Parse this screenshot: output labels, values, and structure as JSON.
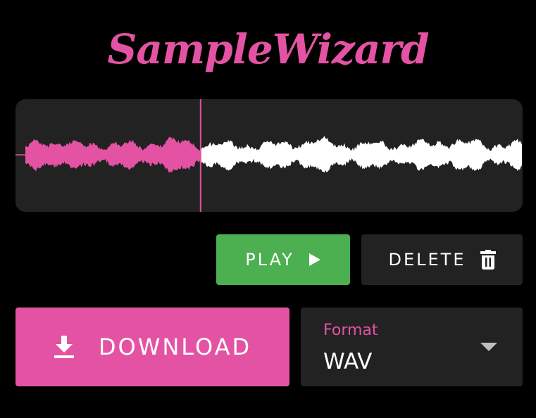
{
  "app": {
    "title": "SampleWizard"
  },
  "colors": {
    "accent": "#e453a3",
    "play_green": "#4caf50",
    "panel": "#222222",
    "background": "#000000",
    "waveform_unplayed": "#ffffff"
  },
  "player": {
    "progress": 0.365
  },
  "controls": {
    "play_label": "PLAY",
    "play_icon": "play-triangle-icon",
    "delete_label": "DELETE",
    "delete_icon": "trash-icon",
    "download_label": "DOWNLOAD",
    "download_icon": "download-arrow-icon"
  },
  "format": {
    "label": "Format",
    "value": "WAV",
    "arrow_icon": "dropdown-arrow-icon"
  }
}
